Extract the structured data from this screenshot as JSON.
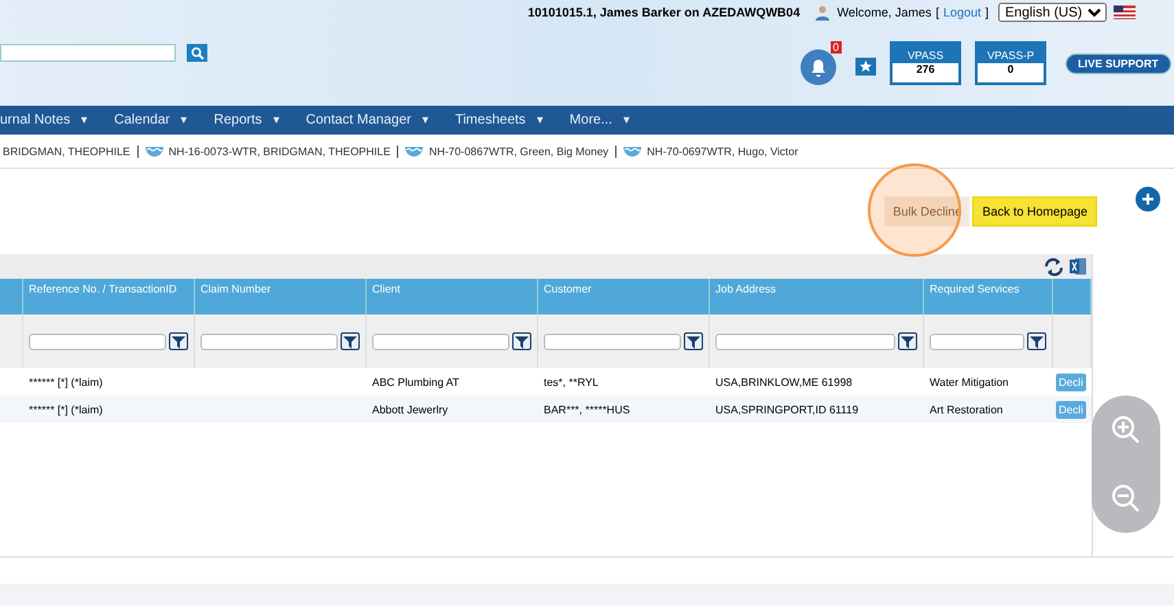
{
  "header": {
    "session": "10101015.1, James Barker on AZEDAWQWB04",
    "welcome": "Welcome, James",
    "open_bracket": "[",
    "logout": "Logout",
    "close_bracket": "]",
    "language": "English (US)",
    "notification_count": "0",
    "badges": [
      {
        "label": "VPASS",
        "value": "276"
      },
      {
        "label": "VPASS-P",
        "value": "0"
      }
    ],
    "live_support": "LIVE SUPPORT"
  },
  "nav": [
    {
      "label": "urnal Notes",
      "caret": "▾"
    },
    {
      "label": "Calendar",
      "caret": "▾"
    },
    {
      "label": "Reports",
      "caret": "▾"
    },
    {
      "label": "Contact Manager",
      "caret": "▾"
    },
    {
      "label": "Timesheets",
      "caret": "▾"
    },
    {
      "label": "More...",
      "caret": "▾"
    }
  ],
  "recent_tabs": [
    {
      "label": "BRIDGMAN, THEOPHILE",
      "icon": false
    },
    {
      "label": "NH-16-0073-WTR, BRIDGMAN, THEOPHILE",
      "icon": true
    },
    {
      "label": "NH-70-0867WTR, Green, Big Money",
      "icon": true
    },
    {
      "label": "NH-70-0697WTR, Hugo, Victor",
      "icon": true
    }
  ],
  "actions": {
    "bulk_decline": "Bulk Decline",
    "back": "Back to Homepage"
  },
  "table": {
    "columns": [
      {
        "filter": false
      },
      {
        "label": "Reference No. / TransactionID",
        "filter": true
      },
      {
        "label": "Claim Number",
        "filter": true
      },
      {
        "label": "Client",
        "filter": true
      },
      {
        "label": "Customer",
        "filter": true
      },
      {
        "label": "Job Address",
        "filter": true
      },
      {
        "label": "Required Services",
        "filter": true
      },
      {
        "filter": false
      }
    ],
    "rows": [
      {
        "cells": [
          "",
          "****** [*] (*laim)",
          "",
          "ABC Plumbing AT",
          "tes*, **RYL",
          "USA,BRINKLOW,ME 61998",
          "Water Mitigation"
        ],
        "action": "Decli"
      },
      {
        "cells": [
          "",
          "****** [*] (*laim)",
          "",
          "Abbott Jewerlry",
          "BAR***, *****HUS",
          "USA,SPRINGPORT,ID 61119",
          "Art Restoration"
        ],
        "action": "Decli"
      }
    ]
  }
}
